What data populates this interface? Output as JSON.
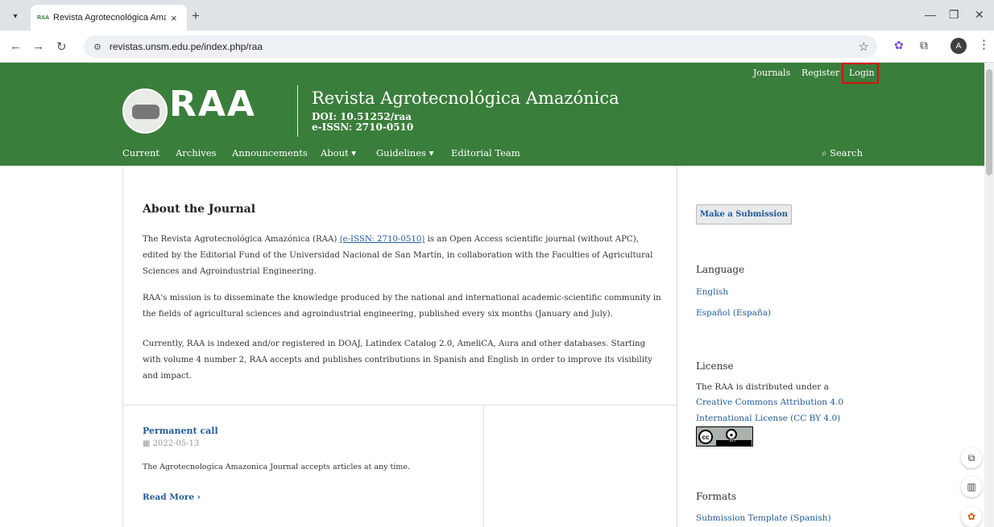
{
  "browser": {
    "tab_favicon": "RAA",
    "tab_title": "Revista Agrotecnológica Amazó",
    "tab_close": "×",
    "new_tab": "+",
    "url": "revistas.unsm.edu.pe/index.php/raa",
    "avatar_letter": "A"
  },
  "header": {
    "user_nav": [
      "Journals",
      "Register",
      "Login"
    ],
    "logo_text": "RAA",
    "journal_name": "Revista Agrotecnológica Amazónica",
    "doi": "DOI: 10.51252/raa",
    "eissn": "e-ISSN: 2710-0510",
    "nav": [
      "Current",
      "Archives",
      "Announcements",
      "About ▾",
      "Guidelines ▾",
      "Editorial Team"
    ],
    "search": "Search"
  },
  "main": {
    "about_title": "About the Journal",
    "p1_before": "The Revista Agrotecnológica Amazónica (RAA) ",
    "p1_link": "(e-ISSN: 2710-0510)",
    "p1_after": " is an Open Access scientific journal (without APC), edited by the Editorial Fund of the Universidad Nacional de San Martín, in collaboration with the Faculties of Agricultural Sciences and Agroindustrial Engineering.",
    "p2": "RAA's mission is to disseminate the knowledge produced by the national and international academic-scientific community in the fields of agricultural sciences and agroindustrial engineering, published every six months (January and July).",
    "p3": "Currently, RAA is indexed and/or registered in DOAJ, Latindex Catalog 2.0, AmeliCA, Aura and other databases. Starting with volume 4 number 2, RAA accepts and publishes contributions in Spanish and English in order to improve its visibility and impact.",
    "announcement": {
      "title": "Permanent call",
      "date": "2022-05-13",
      "text": "The Agrotecnologica Amazonica  Journal accepts articles at any time.",
      "read_more": "Read More"
    }
  },
  "sidebar": {
    "submit": "Make a Submission",
    "language_head": "Language",
    "languages": [
      "English",
      "Español (España)"
    ],
    "license_head": "License",
    "license_text": "The RAA is distributed under a",
    "license_link1": "Creative Commons Attribution 4.0",
    "license_link2": "International License (CC BY 4.0)",
    "cc_label": "cc",
    "by_label": "BY",
    "formats_head": "Formats",
    "formats_link": "Submission Template (Spanish)"
  }
}
